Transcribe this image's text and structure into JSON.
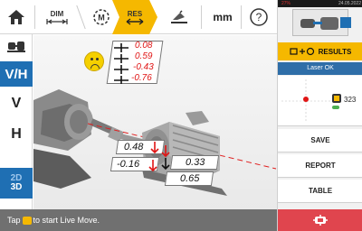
{
  "toolbar": {
    "home_icon": "home-icon",
    "dim_label": "DIM",
    "measure_label": "M",
    "results_label": "RES",
    "report_icon": "report-icon",
    "units_label": "mm",
    "help_label": "?"
  },
  "leftbar": {
    "vh_label": "V/H",
    "v_label": "V",
    "h_label": "H",
    "view_2d": "2D",
    "view_3d": "3D"
  },
  "results": {
    "top_values": [
      "0.08",
      "0.59",
      "-0.43",
      "-0.76"
    ],
    "coupling_vertical": [
      "0.48",
      "-0.16"
    ],
    "coupling_horizontal": [
      "0.33",
      "0.65"
    ]
  },
  "statusbar": {
    "prefix": "Tap",
    "suffix": "to start Live Move."
  },
  "rightpanel": {
    "statusbar_battery": "27%",
    "statusbar_date": "24.05.2022",
    "results_label": "RESULTS",
    "laser_status": "Laser OK",
    "sensor_value": "323",
    "save_label": "SAVE",
    "report_label": "REPORT",
    "table_label": "TABLE"
  },
  "colors": {
    "accent_yellow": "#f5b800",
    "accent_blue": "#1f6fb3",
    "value_red": "#e01515",
    "live_move_red": "#e0454e",
    "status_gray": "#707070"
  }
}
